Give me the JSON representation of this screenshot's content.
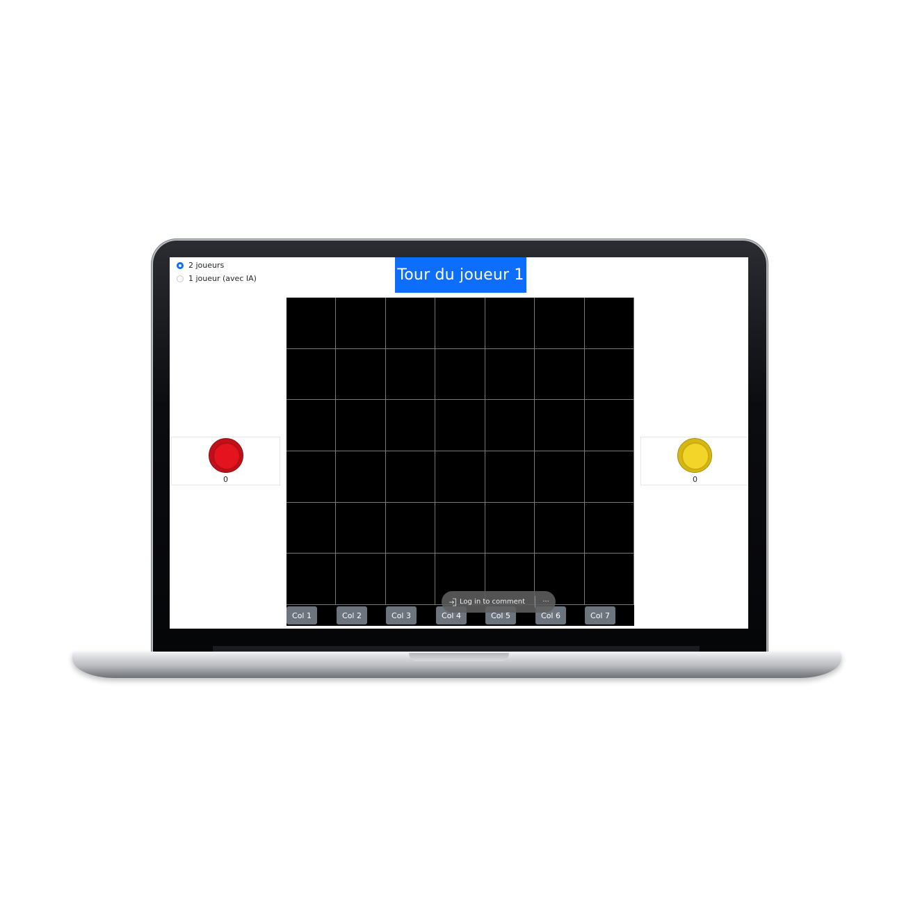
{
  "game": {
    "mode_options": [
      {
        "label": "2 joueurs",
        "checked": true
      },
      {
        "label": "1 joueur (avec IA)",
        "checked": false
      }
    ],
    "turn_banner": "Tour du joueur 1",
    "board": {
      "rows": 6,
      "columns": 7
    },
    "column_buttons": [
      "Col 1",
      "Col 2",
      "Col 3",
      "Col 4",
      "Col 5",
      "Col 6",
      "Col 7"
    ],
    "players": [
      {
        "token_color": "#e3141d",
        "score": "0"
      },
      {
        "token_color": "#f3d52a",
        "score": "0"
      }
    ],
    "colors": {
      "accent": "#0d6efd",
      "button": "#6c757d",
      "board": "#000000"
    }
  },
  "comment_bar": {
    "login_label": "Log in to comment",
    "more_label": "···",
    "icon": "login-icon"
  }
}
